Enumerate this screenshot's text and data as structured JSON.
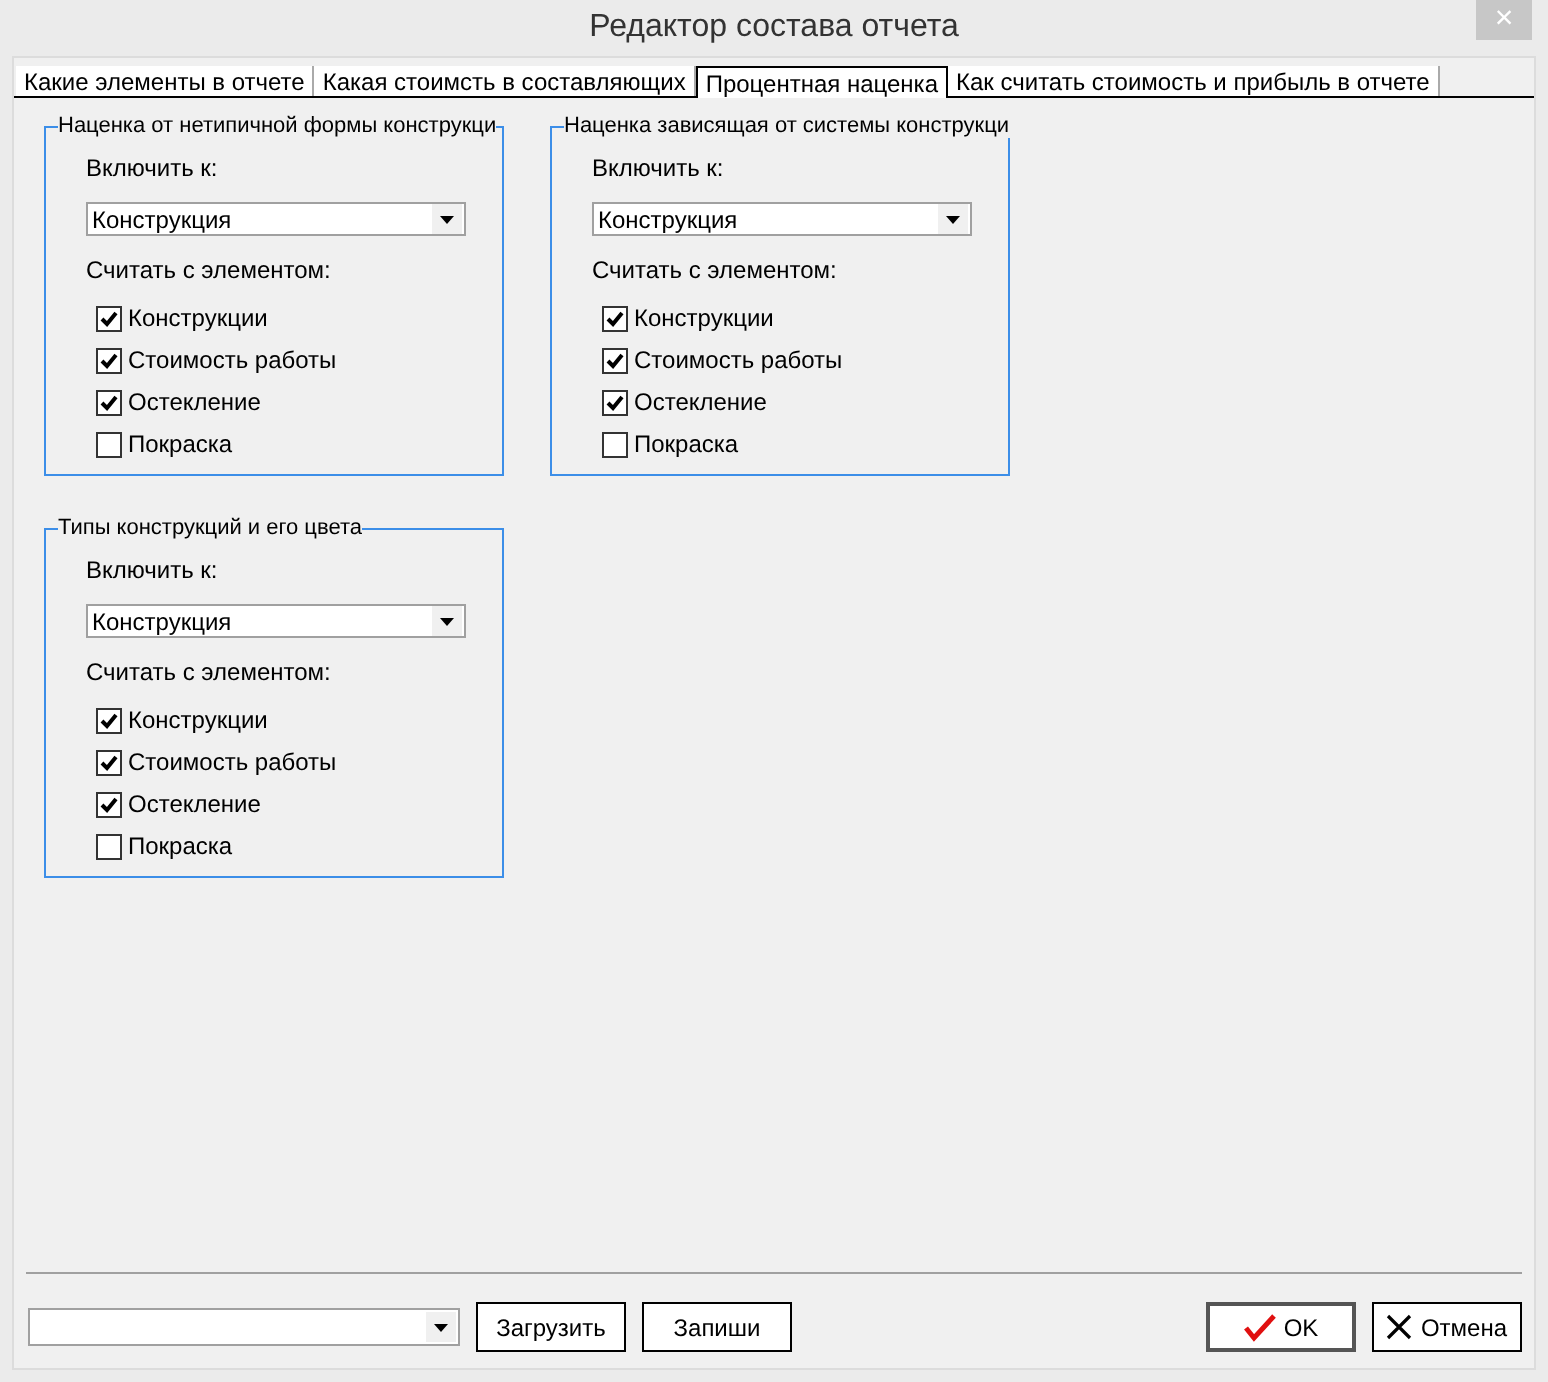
{
  "window": {
    "title": "Редактор состава отчета",
    "close": "×"
  },
  "tabs": [
    {
      "label": "Какие элементы в отчете",
      "selected": false
    },
    {
      "label": "Какая стоимсть в составляющих",
      "selected": false
    },
    {
      "label": "Процентная наценка",
      "selected": true
    },
    {
      "label": "Как считать стоимость и прибыль в отчете",
      "selected": false
    }
  ],
  "groups": [
    {
      "title": "Наценка от нетипичной формы конструкци",
      "include_label": "Включить к:",
      "include_value": "Конструкция",
      "count_label": "Считать с элементом:",
      "options": [
        {
          "label": "Конструкции",
          "checked": true
        },
        {
          "label": "Стоимость работы",
          "checked": true
        },
        {
          "label": "Остекление",
          "checked": true
        },
        {
          "label": "Покраска",
          "checked": false
        }
      ]
    },
    {
      "title": "Наценка зависящая от системы конструкци",
      "include_label": "Включить к:",
      "include_value": "Конструкция",
      "count_label": "Считать с элементом:",
      "options": [
        {
          "label": "Конструкции",
          "checked": true
        },
        {
          "label": "Стоимость работы",
          "checked": true
        },
        {
          "label": "Остекление",
          "checked": true
        },
        {
          "label": "Покраска",
          "checked": false
        }
      ]
    },
    {
      "title": "Типы конструкций и его цвета",
      "include_label": "Включить к:",
      "include_value": "Конструкция",
      "count_label": "Считать с элементом:",
      "options": [
        {
          "label": "Конструкции",
          "checked": true
        },
        {
          "label": "Стоимость работы",
          "checked": true
        },
        {
          "label": "Остекление",
          "checked": true
        },
        {
          "label": "Покраска",
          "checked": false
        }
      ]
    }
  ],
  "footer": {
    "buttons": [
      "Загрузить",
      "Запиши"
    ],
    "ok": "OK",
    "cancel": "Отмена"
  }
}
